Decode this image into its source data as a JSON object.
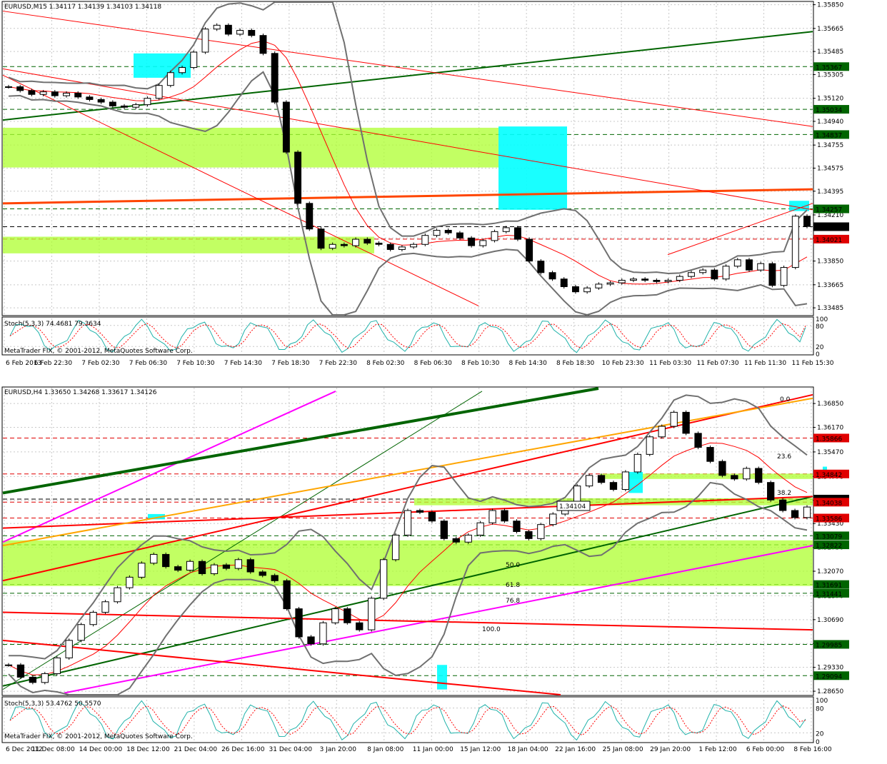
{
  "colors": {
    "background": "#ffffff",
    "grid": "#c8c8c8",
    "bull_candle": "#000000",
    "bear_candle": "#000000",
    "zone_green": "#adff2f",
    "zone_cyan": "#00ffff",
    "bollinger": "#707070",
    "ma_red": "#ff0000",
    "trend_green": "#006400",
    "trend_orange": "#ff4500",
    "trend_magenta": "#ff00ff",
    "trend_gold": "#ffa500",
    "fib_blue": "#0000cd",
    "stoch_main": "#20b2aa",
    "stoch_signal": "#ff0000",
    "price_tag_green": "#006400",
    "price_tag_red": "#e00000",
    "price_tag_black": "#000000"
  },
  "chart_data": [
    {
      "type": "candlestick",
      "title": "EURUSD,M15  1.34117 1.34139 1.34103 1.34118",
      "symbol": "EURUSD",
      "timeframe": "M15",
      "ohlc": {
        "open": 1.34117,
        "high": 1.34139,
        "low": 1.34103,
        "close": 1.34118
      },
      "ylim": [
        1.3343,
        1.3587
      ],
      "y_ticks": [
        "1.35850",
        "1.35665",
        "1.35485",
        "1.35305",
        "1.35120",
        "1.34940",
        "1.34755",
        "1.34575",
        "1.34395",
        "1.34210",
        "1.34030",
        "1.33850",
        "1.33665",
        "1.33485"
      ],
      "x_ticks": [
        "6 Feb 2013",
        "6 Feb 22:30",
        "7 Feb 02:30",
        "7 Feb 06:30",
        "7 Feb 10:30",
        "7 Feb 14:30",
        "7 Feb 18:30",
        "7 Feb 22:30",
        "8 Feb 02:30",
        "8 Feb 06:30",
        "8 Feb 10:30",
        "8 Feb 14:30",
        "8 Feb 18:30",
        "10 Feb 23:30",
        "11 Feb 03:30",
        "11 Feb 07:30",
        "11 Feb 11:30",
        "11 Feb 15:30"
      ],
      "closes": [
        1.3521,
        1.3518,
        1.3515,
        1.3517,
        1.3514,
        1.3516,
        1.3513,
        1.3511,
        1.3509,
        1.3506,
        1.3505,
        1.3507,
        1.3512,
        1.3522,
        1.3532,
        1.3536,
        1.3548,
        1.3566,
        1.3569,
        1.3562,
        1.3565,
        1.3561,
        1.3547,
        1.3509,
        1.347,
        1.343,
        1.341,
        1.3395,
        1.3398,
        1.3397,
        1.3402,
        1.3399,
        1.3398,
        1.3394,
        1.3396,
        1.3398,
        1.3405,
        1.3409,
        1.3407,
        1.3403,
        1.3397,
        1.3401,
        1.3408,
        1.3411,
        1.3402,
        1.3385,
        1.3376,
        1.3371,
        1.3365,
        1.3361,
        1.3364,
        1.3367,
        1.3368,
        1.337,
        1.3371,
        1.337,
        1.3369,
        1.337,
        1.3373,
        1.3376,
        1.3378,
        1.3371,
        1.3381,
        1.3386,
        1.3378,
        1.3383,
        1.3366,
        1.338,
        1.342,
        1.3412
      ],
      "price_tags": [
        {
          "label": "1.35367",
          "style": "green"
        },
        {
          "label": "1.35034",
          "style": "green"
        },
        {
          "label": "1.34837",
          "style": "green"
        },
        {
          "label": "1.34257",
          "style": "green"
        },
        {
          "label": "1.34118",
          "style": "black"
        },
        {
          "label": "1.34021",
          "style": "red"
        }
      ],
      "indicator": {
        "title": "Stoch(5,3,3) 74.4681 79.3634",
        "name": "Stoch(5,3,3)",
        "main": 74.4681,
        "signal": 79.3634,
        "y_ticks": [
          "100",
          "80",
          "20",
          "0"
        ]
      },
      "copyright": "MetaTrader FIX, © 2001-2012, MetaQuotes Software Corp."
    },
    {
      "type": "candlestick",
      "title": "EURUSD,H4  1.33650 1.34268 1.33617 1.34126",
      "symbol": "EURUSD",
      "timeframe": "H4",
      "ohlc": {
        "open": 1.3365,
        "high": 1.34268,
        "low": 1.33617,
        "close": 1.34126
      },
      "ylim": [
        1.2855,
        1.373
      ],
      "y_ticks": [
        "1.36850",
        "1.36170",
        "1.35470",
        "1.34770",
        "1.34090",
        "1.33430",
        "1.32750",
        "1.32070",
        "1.31370",
        "1.30690",
        "1.30010",
        "1.29330",
        "1.28650"
      ],
      "x_ticks": [
        "6 Dec 2012",
        "11 Dec 08:00",
        "14 Dec 00:00",
        "18 Dec 12:00",
        "21 Dec 04:00",
        "26 Dec 16:00",
        "31 Dec 04:00",
        "3 Jan 20:00",
        "8 Jan 08:00",
        "11 Jan 00:00",
        "15 Jan 12:00",
        "18 Jan 04:00",
        "22 Jan 16:00",
        "25 Jan 08:00",
        "29 Jan 20:00",
        "1 Feb 12:00",
        "6 Feb 00:00",
        "8 Feb 16:00"
      ],
      "closes": [
        1.294,
        1.2905,
        1.289,
        1.2915,
        1.296,
        1.301,
        1.3055,
        1.309,
        1.312,
        1.316,
        1.319,
        1.323,
        1.3255,
        1.322,
        1.321,
        1.3235,
        1.32,
        1.3225,
        1.3215,
        1.324,
        1.3205,
        1.3195,
        1.318,
        1.31,
        1.302,
        1.3,
        1.306,
        1.31,
        1.306,
        1.304,
        1.313,
        1.324,
        1.331,
        1.338,
        1.3375,
        1.335,
        1.33,
        1.329,
        1.331,
        1.3345,
        1.338,
        1.335,
        1.332,
        1.33,
        1.334,
        1.337,
        1.3395,
        1.345,
        1.348,
        1.346,
        1.344,
        1.349,
        1.354,
        1.359,
        1.362,
        1.366,
        1.36,
        1.356,
        1.352,
        1.348,
        1.347,
        1.35,
        1.346,
        1.341,
        1.338,
        1.336,
        1.339
      ],
      "price_tags": [
        {
          "label": "1.35866",
          "style": "red"
        },
        {
          "label": "1.34842",
          "style": "red"
        },
        {
          "label": "1.34126",
          "style": "black"
        },
        {
          "label": "1.34038",
          "style": "red"
        },
        {
          "label": "1.33586",
          "style": "red"
        },
        {
          "label": "1.33079",
          "style": "green"
        },
        {
          "label": "1.32822",
          "style": "green"
        },
        {
          "label": "1.31691",
          "style": "green"
        },
        {
          "label": "1.31441",
          "style": "green"
        },
        {
          "label": "1.29985",
          "style": "green"
        },
        {
          "label": "1.29094",
          "style": "green"
        }
      ],
      "fib_labels": [
        "0.0",
        "23.6",
        "38.2",
        "50.0",
        "61.8",
        "76.8",
        "100.0"
      ],
      "annotation": "1.34104",
      "indicator": {
        "title": "Stoch(5,3,3) 53.4762 50.5570",
        "name": "Stoch(5,3,3)",
        "main": 53.4762,
        "signal": 50.557,
        "y_ticks": [
          "100",
          "80",
          "20",
          "0"
        ]
      },
      "copyright": "MetaTrader FIX, © 2001-2012, MetaQuotes Software Corp."
    }
  ]
}
